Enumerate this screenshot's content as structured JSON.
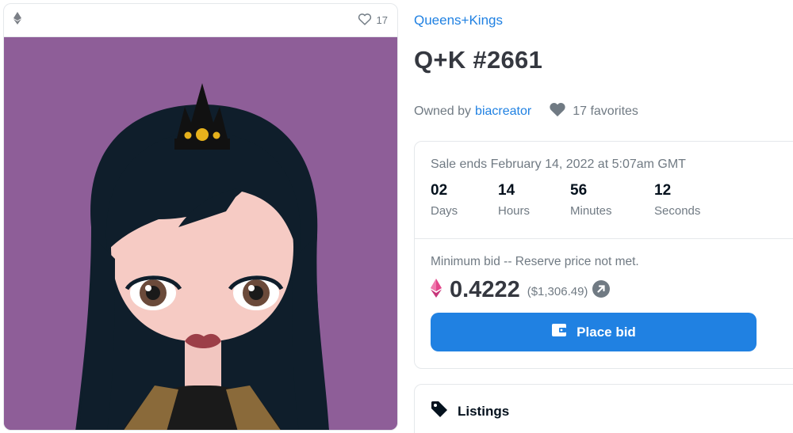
{
  "art": {
    "favorites_count": "17",
    "background_color": "#8e5e98"
  },
  "collection": {
    "name": "Queens+Kings"
  },
  "item": {
    "title": "Q+K #2661"
  },
  "owner": {
    "prefix": "Owned by",
    "name": "biacreator",
    "favorites": "17 favorites"
  },
  "sale": {
    "ends_text": "Sale ends February 14, 2022 at 5:07am GMT",
    "countdown": [
      {
        "value": "02",
        "label": "Days"
      },
      {
        "value": "14",
        "label": "Hours"
      },
      {
        "value": "56",
        "label": "Minutes"
      },
      {
        "value": "12",
        "label": "Seconds"
      }
    ],
    "min_bid_text": "Minimum bid -- Reserve price not met.",
    "price": "0.4222",
    "usd": "($1,306.49)",
    "button_label": "Place bid"
  },
  "listings": {
    "title": "Listings"
  },
  "colors": {
    "accent": "#2081e2",
    "text": "#353840",
    "muted": "#707a83",
    "eth_pink": "#e3468b"
  }
}
